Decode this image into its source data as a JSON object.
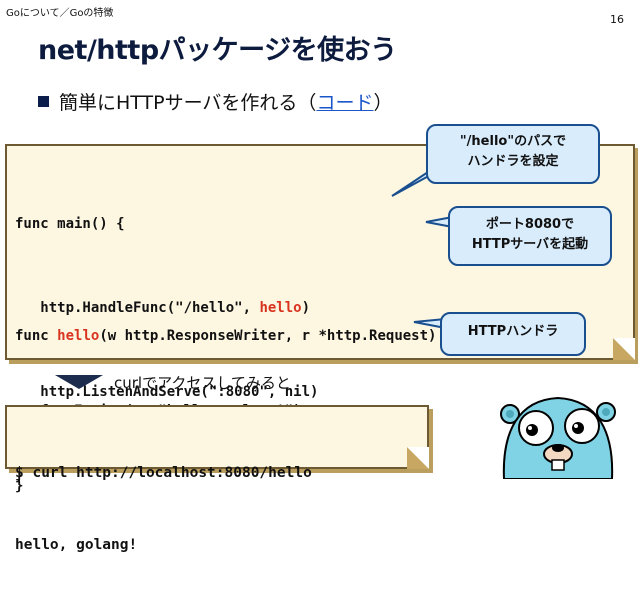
{
  "header": {
    "breadcrumb": "Goについて／Goの特徴",
    "page_number": "16",
    "title": "net/httpパッケージを使おう"
  },
  "bullet": {
    "prefix": "簡単にHTTPサーバを作れる（",
    "link": "コード",
    "suffix": "）"
  },
  "code": {
    "l1": "func main() {",
    "l2_a": "   http.HandleFunc(\"/hello\", ",
    "l2_hl": "hello",
    "l2_b": ")",
    "l3": "   http.ListenAndServe(\":8080\", nil)",
    "l4": "}",
    "l5_a": "func ",
    "l5_hl": "hello",
    "l5_b": "(w http.ResponseWriter, r *http.Request) {",
    "l6": "   fmt.Fprint(w, \"hello, golang!\")",
    "l7": "}"
  },
  "callouts": {
    "c1_line1": "\"/hello\"のパスで",
    "c1_line2": "ハンドラを設定",
    "c2_line1": "ポート8080で",
    "c2_line2": "HTTPサーバを起動",
    "c3": "HTTPハンドラ"
  },
  "curl": {
    "caption": "curlでアクセスしてみると",
    "cmd": "$ curl http://localhost:8080/hello",
    "output": "hello, golang!"
  },
  "colors": {
    "title": "#0d1b3e",
    "link": "#1a55c9",
    "highlight": "#d9341f",
    "code_bg": "#fdf7e2",
    "callout_bg": "#d8ecfc",
    "gopher": "#7fd3e4"
  }
}
